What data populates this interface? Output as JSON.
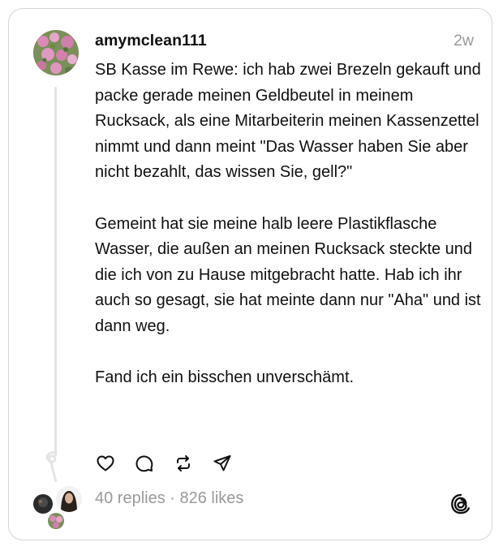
{
  "post": {
    "username": "amymclean111",
    "time": "2w",
    "paragraphs": [
      "SB Kasse im Rewe: ich hab zwei Brezeln gekauft und packe gerade meinen Geldbeutel in meinem Rucksack, als eine Mitarbeiterin meinen Kassenzettel nimmt und dann meint \"Das Wasser haben Sie aber nicht bezahlt, das wissen Sie, gell?\"",
      "Gemeint hat sie meine halb leere Plastikflasche Wasser, die außen an meinen Rucksack steckte und die ich von zu Hause mitgebracht hatte. Hab ich ihr auch so gesagt, sie hat meinte dann nur \"Aha\" und ist dann weg.",
      "Fand ich ein bisschen unverschämt."
    ],
    "stats": "40 replies · 826 likes"
  },
  "icons": {
    "like": "heart-icon",
    "reply": "comment-icon",
    "repost": "repost-icon",
    "share": "send-icon",
    "brand": "threads-logo-icon"
  },
  "colors": {
    "text": "#101010",
    "muted": "#9a9a9a",
    "border": "#d6d6d6",
    "thread_line": "#e4e4e4"
  }
}
